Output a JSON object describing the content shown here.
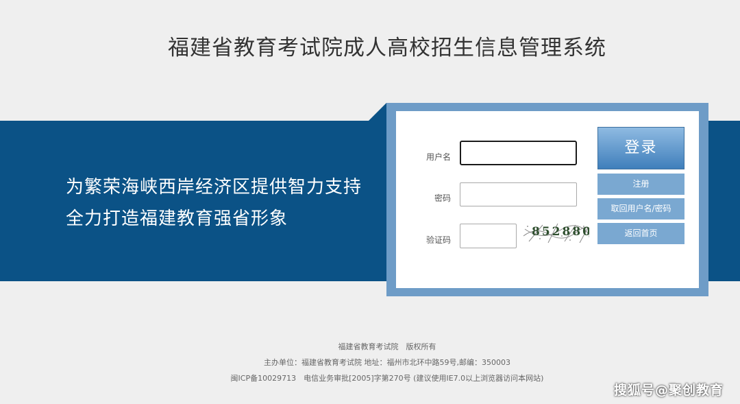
{
  "header": {
    "title": "福建省教育考试院成人高校招生信息管理系统"
  },
  "banner": {
    "slogan_line1": "为繁荣海峡西岸经济区提供智力支持",
    "slogan_line2": "全力打造福建教育强省形象"
  },
  "login": {
    "username_label": "用户名",
    "username_value": "",
    "password_label": "密码",
    "password_value": "",
    "captcha_label": "验证码",
    "captcha_value": "",
    "captcha_image_text": "852880",
    "login_button": "登录",
    "register_button": "注册",
    "recover_button": "取回用户名/密码",
    "home_button": "返回首页"
  },
  "footer": {
    "line1": "福建省教育考试院　版权所有",
    "line2": "主办单位：福建省教育考试院 地址：福州市北环中路59号,邮编：350003",
    "line3": "闽ICP备10029713　电信业务审批[2005]字第270号 (建议使用IE7.0以上浏览器访问本网站)"
  },
  "watermark": "搜狐号@聚创教育",
  "colors": {
    "band": "#0b5286",
    "frame": "#6e9cc7",
    "button": "#7aa8d1",
    "background": "#efefef"
  }
}
